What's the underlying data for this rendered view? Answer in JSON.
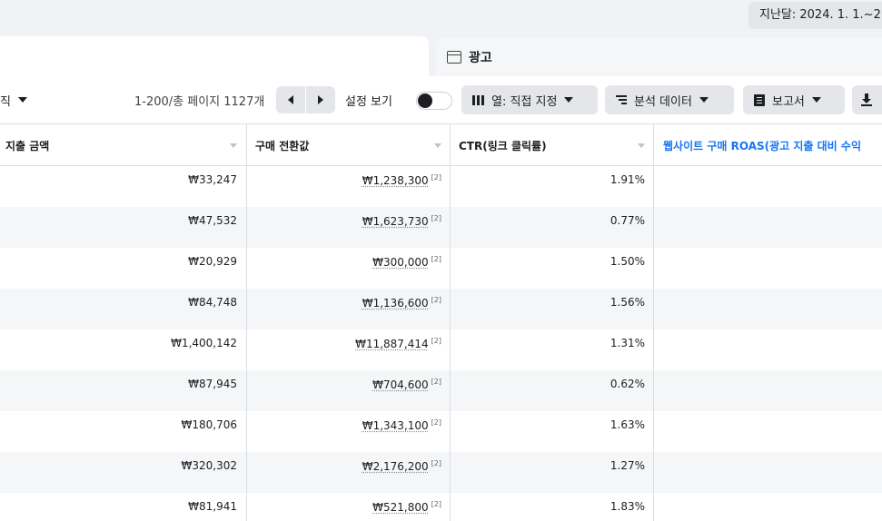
{
  "header": {
    "date_range": "지난달: 2024. 1. 1.~2"
  },
  "tabs": {
    "ads_label": "광고"
  },
  "toolbar": {
    "left_partial": "직",
    "range_text": "1-200/총 페이지 1127개",
    "settings_label": "설정 보기",
    "columns_label": "열: 직접 지정",
    "breakdown_label": "분석 데이터",
    "reports_label": "보고서"
  },
  "table": {
    "headers": {
      "spend": "지출 금액",
      "purchase_value": "구매 전환값",
      "ctr": "CTR(링크 클릭률)",
      "roas": "웹사이트 구매 ROAS(광고 지출 대비 수익"
    },
    "rows": [
      {
        "spend": "₩33,247",
        "value": "₩1,238,300",
        "note": "[2]",
        "ctr": "1.91%"
      },
      {
        "spend": "₩47,532",
        "value": "₩1,623,730",
        "note": "[2]",
        "ctr": "0.77%"
      },
      {
        "spend": "₩20,929",
        "value": "₩300,000",
        "note": "[2]",
        "ctr": "1.50%"
      },
      {
        "spend": "₩84,748",
        "value": "₩1,136,600",
        "note": "[2]",
        "ctr": "1.56%"
      },
      {
        "spend": "₩1,400,142",
        "value": "₩11,887,414",
        "note": "[2]",
        "ctr": "1.31%"
      },
      {
        "spend": "₩87,945",
        "value": "₩704,600",
        "note": "[2]",
        "ctr": "0.62%"
      },
      {
        "spend": "₩180,706",
        "value": "₩1,343,100",
        "note": "[2]",
        "ctr": "1.63%"
      },
      {
        "spend": "₩320,302",
        "value": "₩2,176,200",
        "note": "[2]",
        "ctr": "1.27%"
      },
      {
        "spend": "₩81,941",
        "value": "₩521,800",
        "note": "[2]",
        "ctr": "1.83%"
      }
    ]
  },
  "colors": {
    "link_blue": "#1877f2",
    "border": "#dadde1",
    "button_gray": "#e4e6ea"
  }
}
